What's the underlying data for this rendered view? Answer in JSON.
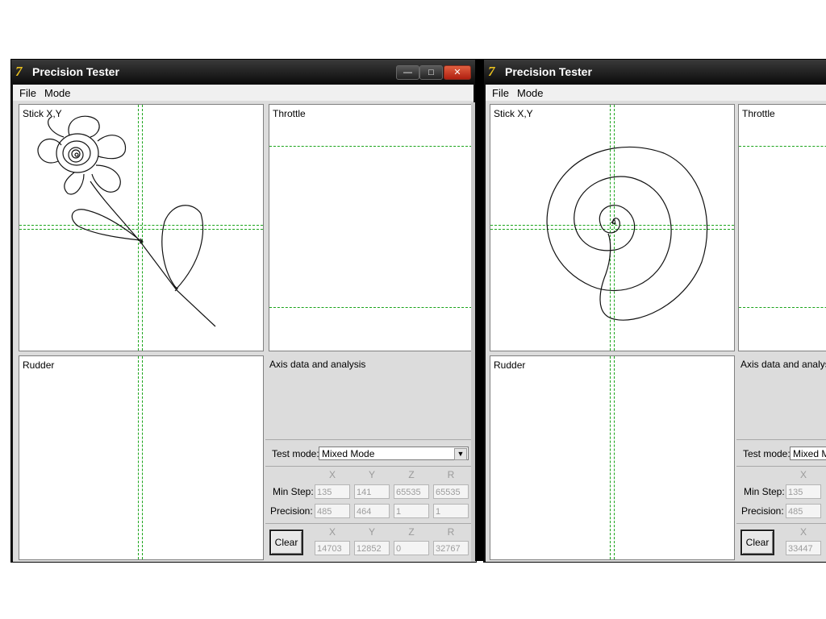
{
  "windows": [
    {
      "id": "left",
      "title": "Precision Tester",
      "icon": "7-logo-icon",
      "controls": {
        "minimize": "—",
        "maximize": "□",
        "close": "✕"
      },
      "menu": [
        "File",
        "Mode"
      ],
      "panels": {
        "stick": "Stick X,Y",
        "throttle": "Throttle",
        "rudder": "Rudder",
        "analysis": "Axis data and analysis"
      },
      "test_mode_label": "Test mode:",
      "test_mode_value": "Mixed Mode",
      "axes": [
        "X",
        "Y",
        "Z",
        "R"
      ],
      "min_step_label": "Min Step:",
      "precision_label": "Precision:",
      "min_step": [
        "135",
        "141",
        "65535",
        "65535"
      ],
      "precision": [
        "485",
        "464",
        "1",
        "1"
      ],
      "clear_label": "Clear",
      "positions": [
        "14703",
        "12852",
        "0",
        "32767"
      ]
    },
    {
      "id": "right",
      "title": "Precision Tester",
      "icon": "7-logo-icon",
      "menu": [
        "File",
        "Mode"
      ],
      "panels": {
        "stick": "Stick X,Y",
        "throttle": "Throttle",
        "rudder": "Rudder",
        "analysis": "Axis data and analysis"
      },
      "test_mode_label": "Test mode:",
      "test_mode_value": "Mixed Mo",
      "axes": [
        "X"
      ],
      "min_step_label": "Min Step:",
      "precision_label": "Precision:",
      "min_step": [
        "135"
      ],
      "precision": [
        "485"
      ],
      "clear_label": "Clear",
      "positions": [
        "33447"
      ]
    }
  ],
  "colors": {
    "guide": "#1aa41a",
    "titlebar": "#1a1a1a",
    "close": "#c83a20"
  }
}
